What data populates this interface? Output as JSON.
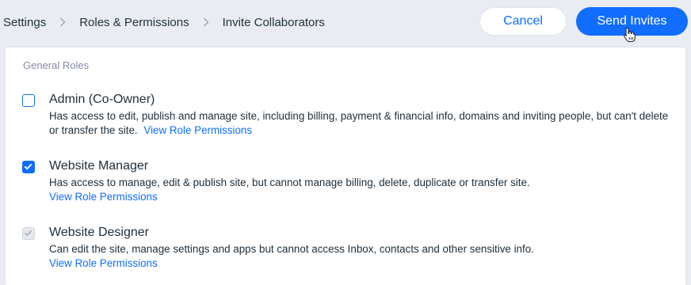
{
  "breadcrumb": {
    "items": [
      {
        "label": "Settings"
      },
      {
        "label": "Roles & Permissions"
      },
      {
        "label": "Invite Collaborators"
      }
    ]
  },
  "header": {
    "cancel_label": "Cancel",
    "send_label": "Send Invites"
  },
  "section": {
    "title": "General Roles"
  },
  "roles": [
    {
      "title": "Admin (Co-Owner)",
      "checked": false,
      "disabled": false,
      "description": "Has access to edit, publish and manage site, including billing, payment & financial info, domains and inviting people, but can't delete or transfer the site.",
      "link": "View Role Permissions"
    },
    {
      "title": "Website Manager",
      "checked": true,
      "disabled": false,
      "description": "Has access to manage, edit & publish site, but cannot manage billing, delete, duplicate or transfer site.",
      "link": "View Role Permissions"
    },
    {
      "title": "Website Designer",
      "checked": true,
      "disabled": true,
      "description": "Can edit the site, manage settings and apps but cannot access Inbox, contacts and other sensitive info.",
      "link": "View Role Permissions"
    }
  ],
  "colors": {
    "accent": "#116dff",
    "background": "#e9edf3",
    "text": "#20303c",
    "muted": "#868aa5"
  },
  "icons": {
    "separator": "chevron-right-icon",
    "cursor": "hand-pointer-icon",
    "check": "checkmark-icon"
  }
}
